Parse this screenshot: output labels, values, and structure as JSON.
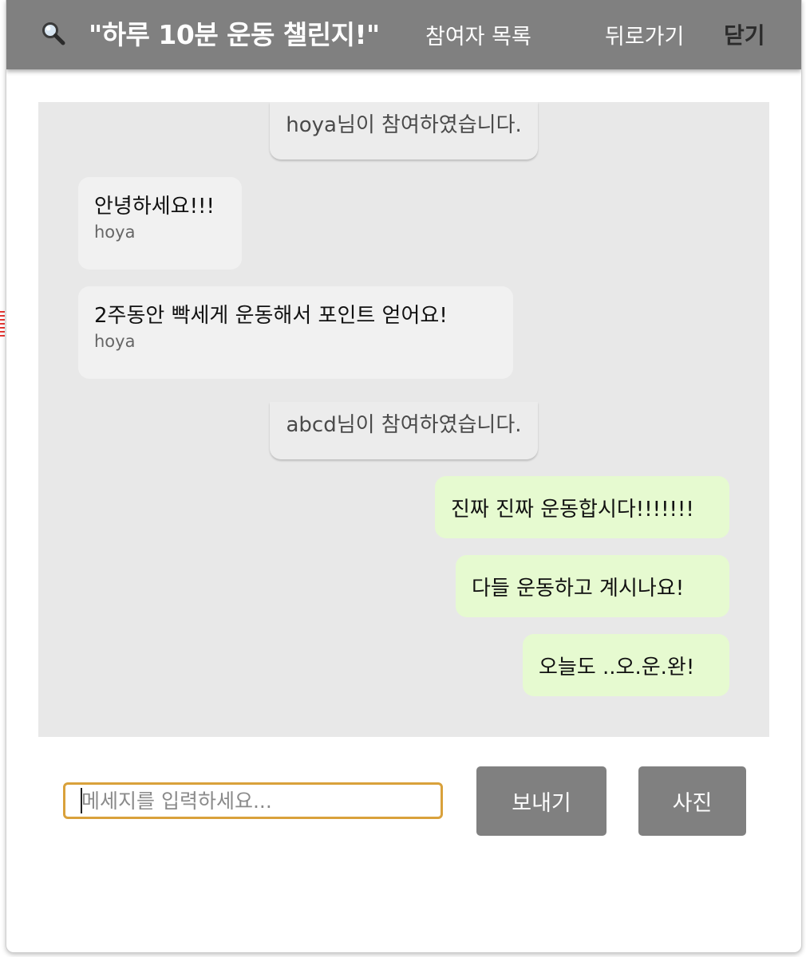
{
  "header": {
    "search_icon": "search-icon",
    "title": "\"하루 10분 운동 챌린지!\"",
    "participants_label": "참여자 목록",
    "back_label": "뒤로가기",
    "close_label": "닫기"
  },
  "messages": [
    {
      "type": "system",
      "text": "hoya님이 참여하였습니다."
    },
    {
      "type": "received",
      "text": "안녕하세요!!!",
      "author": "hoya"
    },
    {
      "type": "received",
      "text": "2주동안 빡세게 운동해서 포인트 얻어요!",
      "author": "hoya"
    },
    {
      "type": "system",
      "text": "abcd님이 참여하였습니다."
    },
    {
      "type": "sent",
      "text": "진짜 진짜 운동합시다!!!!!!!"
    },
    {
      "type": "sent",
      "text": "다들 운동하고 계시나요!"
    },
    {
      "type": "sent",
      "text": "오늘도 ..오.운.완!"
    }
  ],
  "composer": {
    "placeholder": "메세지를 입력하세요...",
    "value": "",
    "send_label": "보내기",
    "photo_label": "사진"
  },
  "colors": {
    "header_bg": "#808080",
    "chat_bg": "#e8e8e8",
    "received_bubble": "#f1f1f1",
    "sent_bubble": "#e6fad0",
    "input_border": "#d9a13b",
    "button_bg": "#808080"
  }
}
